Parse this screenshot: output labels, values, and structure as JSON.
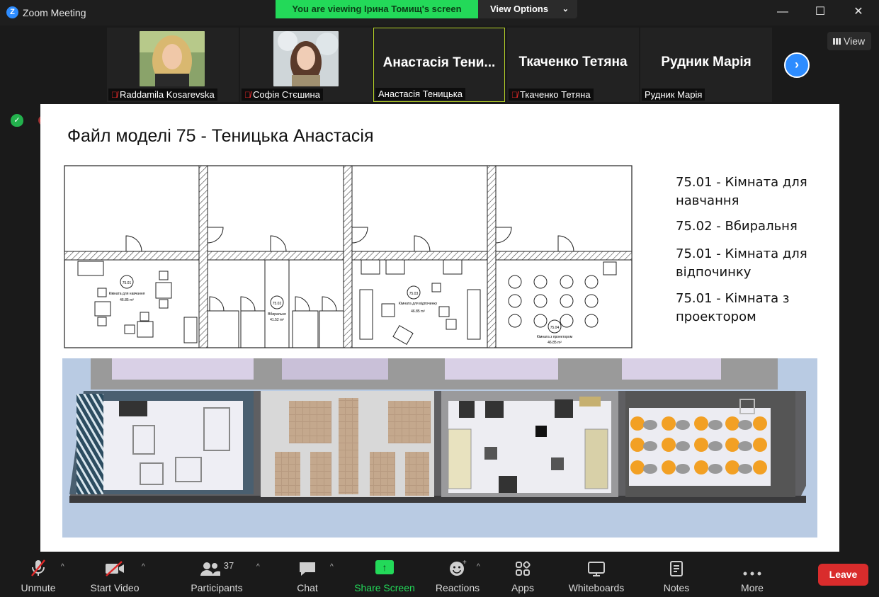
{
  "window": {
    "title": "Zoom Meeting",
    "logo_letter": "Z",
    "minimize": "—",
    "maximize": "☐",
    "close": "✕"
  },
  "banner": {
    "text": "You are viewing Ірина Томищ's screen",
    "options_label": "View Options",
    "chevron": "⌄"
  },
  "participants_strip": [
    {
      "label": "Raddamila Kosarevska",
      "muted": true,
      "type": "photo"
    },
    {
      "label": "Софія Стєшина",
      "muted": true,
      "type": "photo"
    },
    {
      "big_name": "Анастасія Тени...",
      "label": "Анастасія Теницька",
      "muted": false,
      "type": "name"
    },
    {
      "big_name": "Ткаченко Тетяна",
      "label": "Ткаченко Тетяна",
      "muted": true,
      "type": "name"
    },
    {
      "big_name": "Рудник Марія",
      "label": "Рудник Марія",
      "muted": false,
      "type": "name"
    }
  ],
  "view_button": "View",
  "next_arrow": "›",
  "slide": {
    "title": "Файл моделі 75 - Теницька Анастасія",
    "legend": [
      "75.01 - Кімната для навчання",
      "75.02 - Вбиральня",
      "75.01 - Кімната для відпочинку",
      "75.01 - Кімната з проектором"
    ],
    "plan_labels": {
      "room1_id": "75.01",
      "room1_name": "Кімната для навчання",
      "room1_area": "46.85 m²",
      "room2_id": "75.02",
      "room2_name": "Вбиральня",
      "room2_area": "41.52 m²",
      "room3_id": "75.03",
      "room3_name": "Кімната для відпочинку",
      "room3_area": "46.85 m²",
      "room4_id": "75.04",
      "room4_name": "Кімната з проектором",
      "room4_area": "46.85 m²"
    }
  },
  "toolbar": {
    "unmute": "Unmute",
    "start_video": "Start Video",
    "participants": "Participants",
    "participants_count": "37",
    "chat": "Chat",
    "share_screen": "Share Screen",
    "reactions": "Reactions",
    "apps": "Apps",
    "whiteboards": "Whiteboards",
    "notes": "Notes",
    "more": "More",
    "leave": "Leave",
    "caret": "^"
  },
  "colors": {
    "accent_green": "#23d959",
    "zoom_blue": "#2d8cff",
    "leave_red": "#d92c2c"
  }
}
